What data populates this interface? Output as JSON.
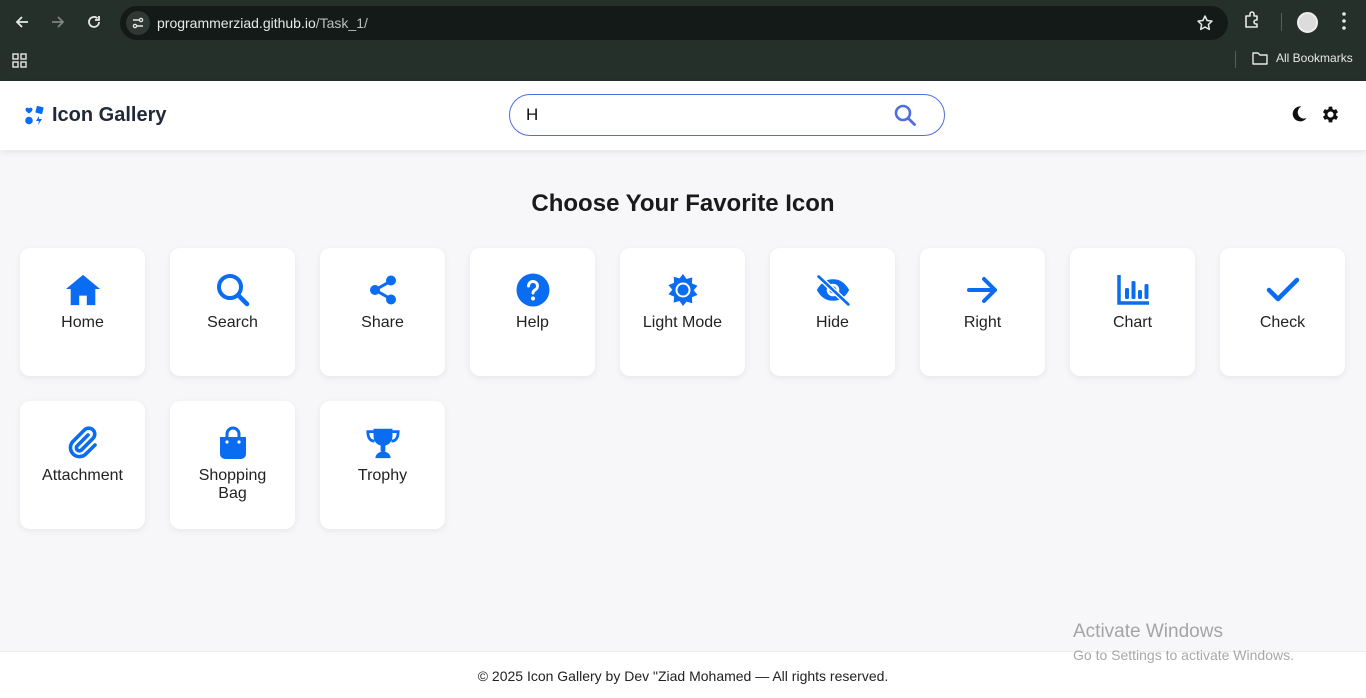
{
  "browser": {
    "url_host": "programmerziad.github.io",
    "url_path": "/Task_1/",
    "bookmarks_label": "All Bookmarks",
    "back_icon": "arrow-left-icon",
    "forward_icon": "arrow-right-icon",
    "reload_icon": "reload-icon"
  },
  "header": {
    "brand_icon": "icons-icon",
    "brand_name": "Icon Gallery",
    "search_value": "H",
    "search_icon": "search-icon",
    "theme_icon": "moon-icon",
    "settings_icon": "gear-icon"
  },
  "main": {
    "title": "Choose Your Favorite Icon",
    "icons": [
      {
        "label": "Home",
        "icon": "home-icon"
      },
      {
        "label": "Search",
        "icon": "search-icon"
      },
      {
        "label": "Share",
        "icon": "share-icon"
      },
      {
        "label": "Help",
        "icon": "help-icon"
      },
      {
        "label": "Light Mode",
        "icon": "sun-icon"
      },
      {
        "label": "Hide",
        "icon": "eye-slash-icon"
      },
      {
        "label": "Right",
        "icon": "arrow-right-icon"
      },
      {
        "label": "Chart",
        "icon": "chart-icon"
      },
      {
        "label": "Check",
        "icon": "check-icon"
      },
      {
        "label": "Attachment",
        "icon": "paperclip-icon"
      },
      {
        "label": "Shopping Bag",
        "icon": "shopping-bag-icon"
      },
      {
        "label": "Trophy",
        "icon": "trophy-icon"
      }
    ]
  },
  "footer": {
    "text": "© 2025 Icon Gallery by Dev \"Ziad Mohamed — All rights reserved."
  },
  "os_watermark": {
    "line1": "Activate Windows",
    "line2": "Go to Settings to activate Windows."
  },
  "colors": {
    "accent": "#0a6cf0",
    "search_border": "#4f6edc",
    "chrome_bg": "#26302b"
  }
}
